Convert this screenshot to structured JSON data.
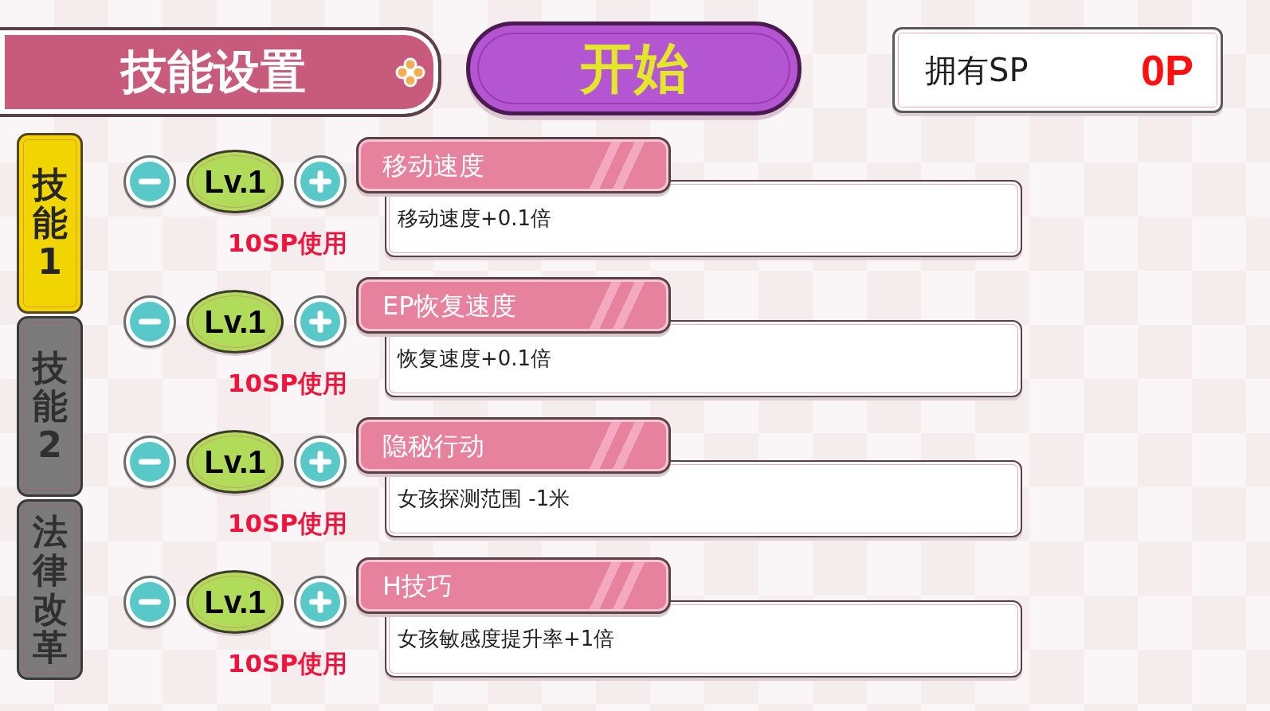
{
  "header": {
    "title": "技能设置"
  },
  "start_button": {
    "label": "开始"
  },
  "sp_panel": {
    "label": "拥有SP",
    "value": "0P"
  },
  "side_tabs": [
    {
      "label": "技能1",
      "selected": true
    },
    {
      "label": "技能2",
      "selected": false
    },
    {
      "label": "法律改革",
      "selected": false
    }
  ],
  "skills": [
    {
      "name": "移动速度",
      "level_text": "Lv.1",
      "cost": "10SP使用",
      "description": "移动速度+0.1倍"
    },
    {
      "name": "EP恢复速度",
      "level_text": "Lv.1",
      "cost": "10SP使用",
      "description": "恢复速度+0.1倍"
    },
    {
      "name": "隐秘行动",
      "level_text": "Lv.1",
      "cost": "10SP使用",
      "description": "女孩探测范围 -1米"
    },
    {
      "name": "H技巧",
      "level_text": "Lv.1",
      "cost": "10SP使用",
      "description": "女孩敏感度提升率+1倍"
    }
  ]
}
